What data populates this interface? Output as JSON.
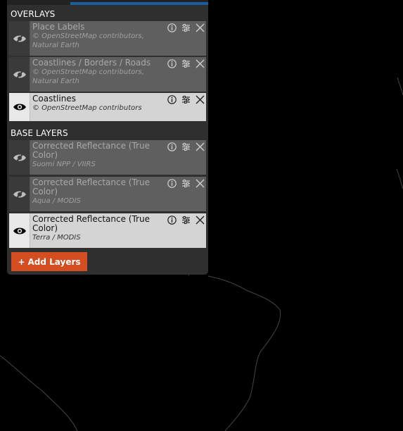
{
  "overlays": {
    "heading": "OVERLAYS",
    "items": [
      {
        "name": "Place Labels",
        "attribution": [
          "© OpenStreetMap contributors,",
          "Natural Earth"
        ],
        "visible": false
      },
      {
        "name": "Coastlines / Borders / Roads",
        "attribution": [
          "© OpenStreetMap contributors,",
          "Natural Earth"
        ],
        "visible": false
      },
      {
        "name": "Coastlines",
        "attribution": [
          "© OpenStreetMap contributors"
        ],
        "visible": true
      }
    ]
  },
  "base_layers": {
    "heading": "BASE LAYERS",
    "items": [
      {
        "name": "Corrected Reflectance (True Color)",
        "attribution": [
          "Suomi NPP / VIIRS"
        ],
        "visible": false
      },
      {
        "name": "Corrected Reflectance (True Color)",
        "attribution": [
          "Aqua / MODIS"
        ],
        "visible": false
      },
      {
        "name": "Corrected Reflectance (True Color)",
        "attribution": [
          "Terra / MODIS"
        ],
        "visible": true
      }
    ]
  },
  "add_button": {
    "label": "Add Layers",
    "icon": "+"
  },
  "icons": {
    "info": "info-icon",
    "settings": "sliders-icon",
    "remove": "close-icon",
    "visible": "eye-icon",
    "hidden": "eye-slash-icon"
  },
  "colors": {
    "accent": "#d54e21",
    "tab_active": "#1a5fa0",
    "panel": "#2f2f2f"
  }
}
